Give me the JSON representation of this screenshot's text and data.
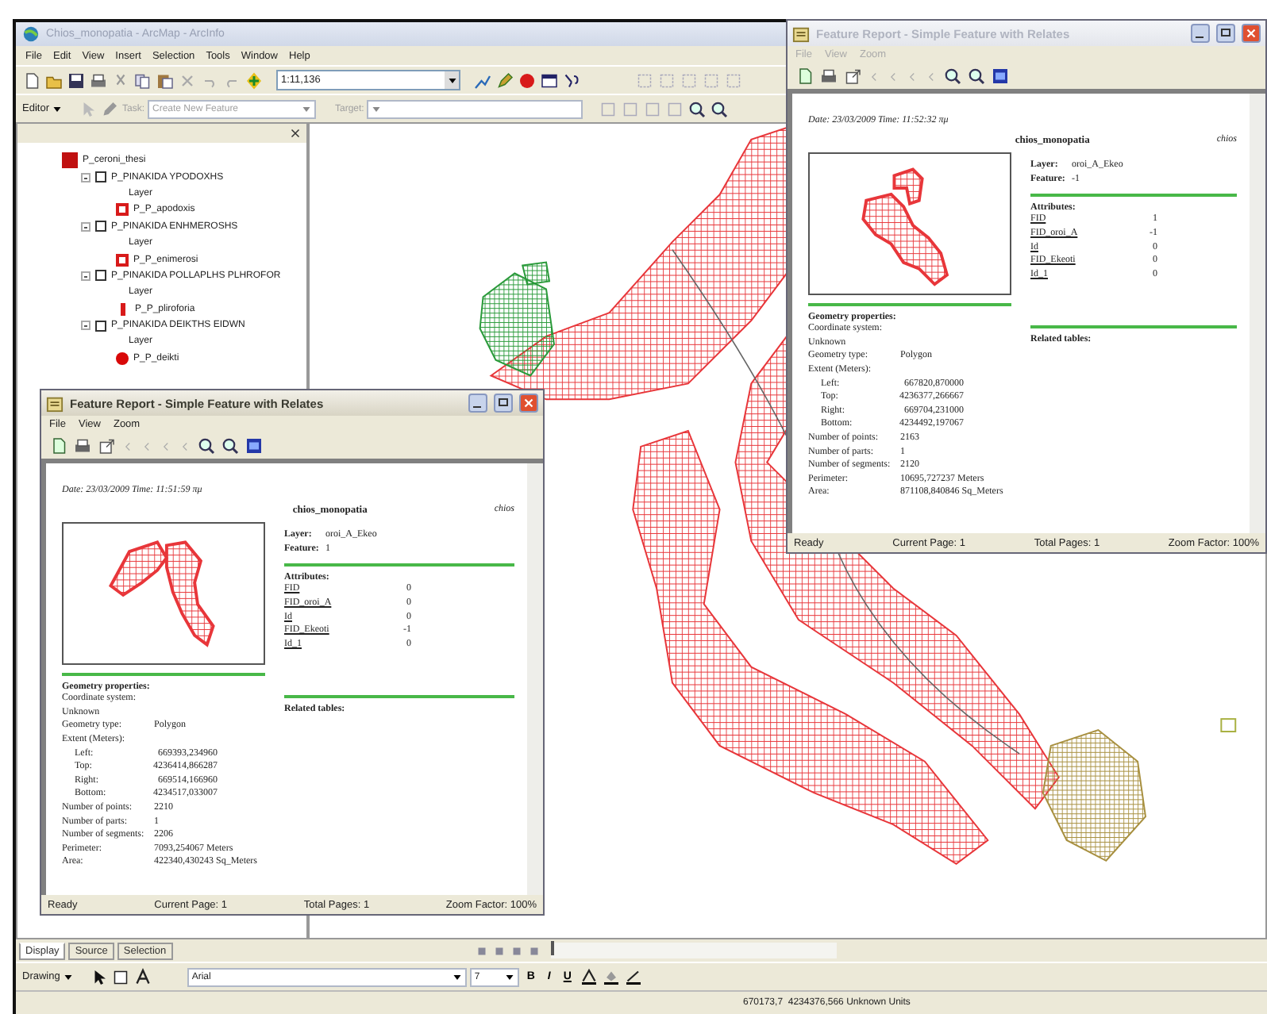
{
  "window": {
    "title": "Chios_monopatia - ArcMap - ArcInfo"
  },
  "menu": [
    "File",
    "Edit",
    "View",
    "Insert",
    "Selection",
    "Tools",
    "Window",
    "Help"
  ],
  "standard_toolbar": {
    "scale": "1:11,136"
  },
  "editor_toolbar": {
    "editor": "Editor",
    "task_label": "Task:",
    "task": "Create New Feature",
    "target_label": "Target:"
  },
  "toc": {
    "items": [
      {
        "kind": "square",
        "label": "P_ceroni_thesi"
      },
      {
        "kind": "layer",
        "label": "P_PINAKIDA YPODOXHS",
        "checked": false,
        "expanded": true,
        "children": [
          {
            "kind": "note",
            "label": "Layer"
          },
          {
            "kind": "flag",
            "label": "P_P_apodoxis"
          }
        ]
      },
      {
        "kind": "layer",
        "label": "P_PINAKIDA ENHMEROSHS",
        "checked": false,
        "expanded": true,
        "children": [
          {
            "kind": "note",
            "label": "Layer"
          },
          {
            "kind": "flag",
            "label": "P_P_enimerosi"
          }
        ]
      },
      {
        "kind": "layer",
        "label": "P_PINAKIDA POLLAPLHS PLHROFOR",
        "checked": false,
        "expanded": true,
        "children": [
          {
            "kind": "note",
            "label": "Layer"
          },
          {
            "kind": "pin",
            "label": "P_P_pliroforia"
          }
        ]
      },
      {
        "kind": "layer",
        "label": "P_PINAKIDA DEIKTHS EIDWN",
        "checked": false,
        "expanded": true,
        "children": [
          {
            "kind": "note",
            "label": "Layer"
          },
          {
            "kind": "circle",
            "label": "P_P_deikti"
          }
        ]
      }
    ]
  },
  "toc_tabs": [
    {
      "label": "Display",
      "selected": true
    },
    {
      "label": "Source",
      "selected": false
    },
    {
      "label": "Selection",
      "selected": false
    }
  ],
  "drawing_toolbar": {
    "label": "Drawing",
    "font": "Arial",
    "size": "7",
    "format_buttons": [
      "B",
      "I",
      "U"
    ]
  },
  "status_bar": {
    "coordinates": "670173,7  4234376,566 Unknown Units"
  },
  "reports": [
    {
      "active": false,
      "title": "Feature Report - Simple Feature with Relates",
      "menu": [
        "File",
        "View",
        "Zoom"
      ],
      "date": "Date: 23/03/2009 Time: 11:52:32 πμ",
      "name": "chios_monopatia",
      "user": "chios",
      "layer": {
        "label": "Layer:",
        "value": "oroi_A_Ekeo"
      },
      "feature": {
        "label": "Feature:",
        "value": "-1"
      },
      "attributes_heading": "Attributes:",
      "attributes": [
        {
          "name": "FID",
          "value": "1"
        },
        {
          "name": "FID_oroi_A",
          "value": "-1"
        },
        {
          "name": "Id",
          "value": "0"
        },
        {
          "name": "FID_Ekeoti",
          "value": "0"
        },
        {
          "name": "Id_1",
          "value": "0"
        }
      ],
      "geometry": {
        "heading": "Geometry properties:",
        "rows": [
          {
            "label": "Coordinate system:"
          },
          {
            "label": "Unknown"
          },
          {
            "label": "Geometry type:",
            "value": "Polygon"
          },
          {
            "label": "Extent (Meters):",
            "children": [
              {
                "label": "Left:",
                "value": "667820,870000"
              },
              {
                "label": "Top:",
                "value": "4236377,266667"
              },
              {
                "label": "Right:",
                "value": "669704,231000"
              },
              {
                "label": "Bottom:",
                "value": "4234492,197067"
              }
            ]
          },
          {
            "label": "Number of points:",
            "value": "2163"
          },
          {
            "label": "Number of parts:",
            "value": "1"
          },
          {
            "label": "Number of segments:",
            "value": "2120"
          },
          {
            "label": "Perimeter:",
            "value": "10695,727237 Meters"
          },
          {
            "label": "Area:",
            "value": "871108,840846 Sq_Meters"
          }
        ]
      },
      "related": "Related tables:",
      "status": [
        "Ready",
        "Current Page: 1",
        "Total Pages: 1",
        "Zoom Factor: 100%"
      ]
    },
    {
      "active": true,
      "title": "Feature Report - Simple Feature with Relates",
      "menu": [
        "File",
        "View",
        "Zoom"
      ],
      "date": "Date: 23/03/2009 Time: 11:51:59 πμ",
      "name": "chios_monopatia",
      "user": "chios",
      "layer": {
        "label": "Layer:",
        "value": "oroi_A_Ekeo"
      },
      "feature": {
        "label": "Feature:",
        "value": "1"
      },
      "attributes_heading": "Attributes:",
      "attributes": [
        {
          "name": "FID",
          "value": "0"
        },
        {
          "name": "FID_oroi_A",
          "value": "0"
        },
        {
          "name": "Id",
          "value": "0"
        },
        {
          "name": "FID_Ekeoti",
          "value": "-1"
        },
        {
          "name": "Id_1",
          "value": "0"
        }
      ],
      "geometry": {
        "heading": "Geometry properties:",
        "rows": [
          {
            "label": "Coordinate system:"
          },
          {
            "label": "Unknown"
          },
          {
            "label": "Geometry type:",
            "value": "Polygon"
          },
          {
            "label": "Extent (Meters):",
            "children": [
              {
                "label": "Left:",
                "value": "669393,234960"
              },
              {
                "label": "Top:",
                "value": "4236414,866287"
              },
              {
                "label": "Right:",
                "value": "669514,166960"
              },
              {
                "label": "Bottom:",
                "value": "4234517,033007"
              }
            ]
          },
          {
            "label": "Number of points:",
            "value": "2210"
          },
          {
            "label": "Number of parts:",
            "value": "1"
          },
          {
            "label": "Number of segments:",
            "value": "2206"
          },
          {
            "label": "Perimeter:",
            "value": "7093,254067 Meters"
          },
          {
            "label": "Area:",
            "value": "422340,430243 Sq_Meters"
          }
        ]
      },
      "related": "Related tables:",
      "status": [
        "Ready",
        "Current Page: 1",
        "Total Pages: 1",
        "Zoom Factor: 100%"
      ]
    }
  ]
}
